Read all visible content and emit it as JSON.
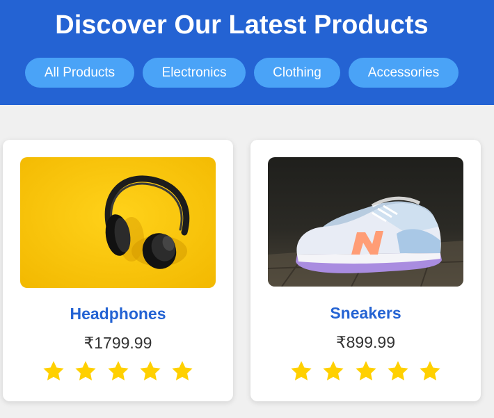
{
  "header": {
    "title": "Discover Our Latest Products"
  },
  "filters": [
    {
      "label": "All Products"
    },
    {
      "label": "Electronics"
    },
    {
      "label": "Clothing"
    },
    {
      "label": "Accessories"
    }
  ],
  "products": [
    {
      "name": "Headphones",
      "price": "₹1799.99",
      "rating": 5,
      "image_icon": "headphones-image"
    },
    {
      "name": "Sneakers",
      "price": "₹899.99",
      "rating": 5,
      "image_icon": "sneakers-image"
    }
  ],
  "colors": {
    "header_bg": "#2463d3",
    "filter_bg": "#4aa3f7",
    "product_name": "#2463d3",
    "star": "#ffd000"
  }
}
